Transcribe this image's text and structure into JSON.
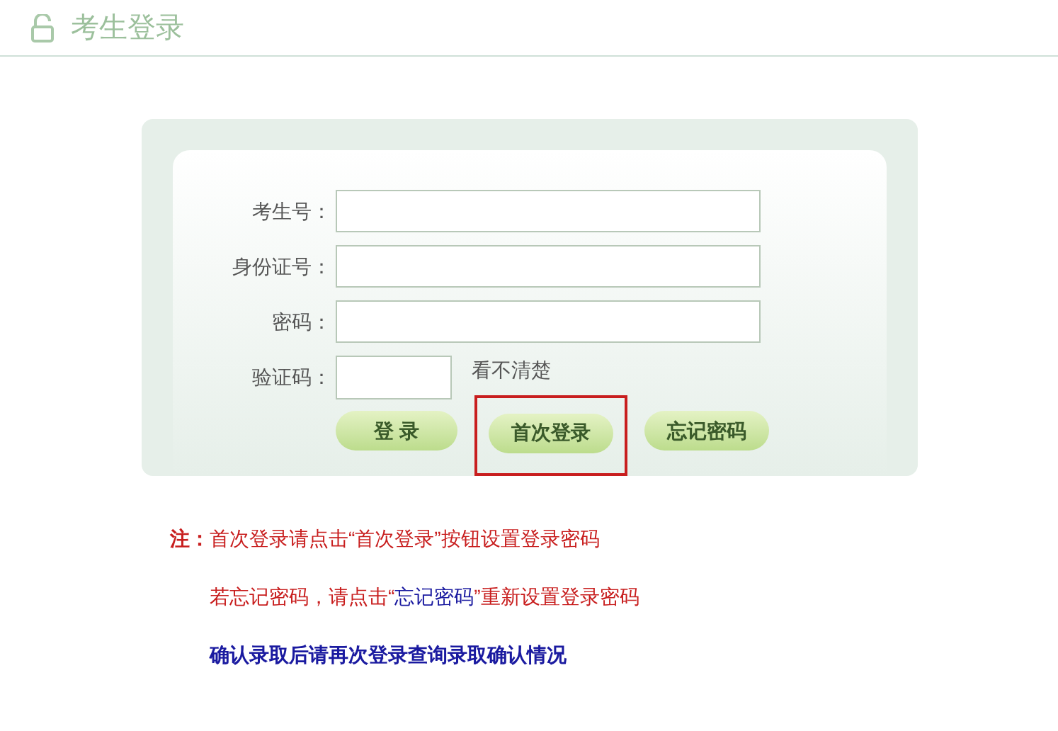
{
  "header": {
    "title": "考生登录"
  },
  "form": {
    "fields": [
      {
        "label": "考生号：",
        "kind": "text"
      },
      {
        "label": "身份证号：",
        "kind": "text"
      },
      {
        "label": "密码：",
        "kind": "password"
      },
      {
        "label": "验证码：",
        "kind": "captcha",
        "hint": "看不清楚"
      }
    ],
    "buttons": [
      {
        "label": "登 录",
        "highlighted": false
      },
      {
        "label": "首次登录",
        "highlighted": true
      },
      {
        "label": "忘记密码",
        "highlighted": false
      }
    ]
  },
  "notes": [
    {
      "kind": "warning",
      "segments": [
        {
          "text": "**注：**首次登录请点击“首次登录”按钮设置登录密码",
          "emphasis": false
        }
      ]
    },
    {
      "kind": "warning",
      "segments": [
        {
          "text": "若忘记密码，请点击“",
          "emphasis": false
        },
        {
          "text": "忘记密码",
          "emphasis": true
        },
        {
          "text": "”重新设置登录密码",
          "emphasis": false
        }
      ]
    },
    {
      "kind": "info",
      "text": "确认录取后请再次登录查询录取确认情况"
    }
  ]
}
